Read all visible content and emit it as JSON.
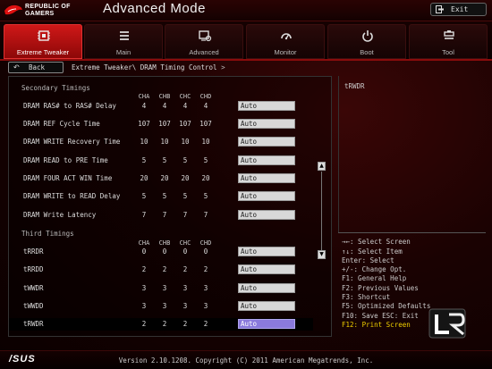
{
  "header": {
    "logo_line1": "REPUBLIC OF",
    "logo_line2": "GAMERS",
    "title": "Advanced Mode",
    "exit_label": "Exit"
  },
  "tabs": [
    {
      "label": "Extreme Tweaker",
      "icon": "cpu-chip-icon",
      "active": true
    },
    {
      "label": "Main",
      "icon": "list-icon",
      "active": false
    },
    {
      "label": "Advanced",
      "icon": "advanced-icon",
      "active": false
    },
    {
      "label": "Monitor",
      "icon": "monitor-gauge-icon",
      "active": false
    },
    {
      "label": "Boot",
      "icon": "power-icon",
      "active": false
    },
    {
      "label": "Tool",
      "icon": "tool-icon",
      "active": false
    }
  ],
  "nav": {
    "back_label": "Back",
    "crumb1": "Extreme Tweaker\\",
    "crumb2": "DRAM Timing Control",
    "crumb_arrow": ">"
  },
  "secondary": {
    "title": "Secondary Timings",
    "columns": [
      "CHA",
      "CHB",
      "CHC",
      "CHD"
    ],
    "rows": [
      {
        "label": "DRAM RAS# to RAS# Delay",
        "values": [
          "4",
          "4",
          "4",
          "4"
        ],
        "setting": "Auto"
      },
      {
        "label": "DRAM REF Cycle Time",
        "values": [
          "107",
          "107",
          "107",
          "107"
        ],
        "setting": "Auto"
      },
      {
        "label": "DRAM WRITE Recovery Time",
        "values": [
          "10",
          "10",
          "10",
          "10"
        ],
        "setting": "Auto"
      },
      {
        "label": "DRAM READ to PRE Time",
        "values": [
          "5",
          "5",
          "5",
          "5"
        ],
        "setting": "Auto"
      },
      {
        "label": "DRAM FOUR ACT WIN Time",
        "values": [
          "20",
          "20",
          "20",
          "20"
        ],
        "setting": "Auto"
      },
      {
        "label": "DRAM WRITE to READ Delay",
        "values": [
          "5",
          "5",
          "5",
          "5"
        ],
        "setting": "Auto"
      },
      {
        "label": "DRAM Write Latency",
        "values": [
          "7",
          "7",
          "7",
          "7"
        ],
        "setting": "Auto"
      }
    ]
  },
  "third": {
    "title": "Third Timings",
    "columns": [
      "CHA",
      "CHB",
      "CHC",
      "CHD"
    ],
    "rows": [
      {
        "label": "tRRDR",
        "values": [
          "0",
          "0",
          "0",
          "0"
        ],
        "setting": "Auto"
      },
      {
        "label": "tRRDD",
        "values": [
          "2",
          "2",
          "2",
          "2"
        ],
        "setting": "Auto"
      },
      {
        "label": "tWWDR",
        "values": [
          "3",
          "3",
          "3",
          "3"
        ],
        "setting": "Auto"
      },
      {
        "label": "tWWDD",
        "values": [
          "3",
          "3",
          "3",
          "3"
        ],
        "setting": "Auto"
      },
      {
        "label": "tRWDR",
        "values": [
          "2",
          "2",
          "2",
          "2"
        ],
        "setting": "Auto",
        "selected": true
      }
    ]
  },
  "help": {
    "title": "tRWDR"
  },
  "keys": [
    "→←: Select Screen",
    "↑↓: Select Item",
    "Enter: Select",
    "+/-: Change Opt.",
    "F1: General Help",
    "F2: Previous Values",
    "F3: Shortcut",
    "F5: Optimized Defaults",
    "F10: Save  ESC: Exit",
    "F12: Print Screen"
  ],
  "footer": {
    "brand": "/SUS",
    "text": "Version 2.10.1208. Copyright (C) 2011 American Megatrends, Inc."
  },
  "colors": {
    "accent_red": "#d01818",
    "selected_value": "#8a7adc",
    "highlight_key": "#f0d000"
  }
}
